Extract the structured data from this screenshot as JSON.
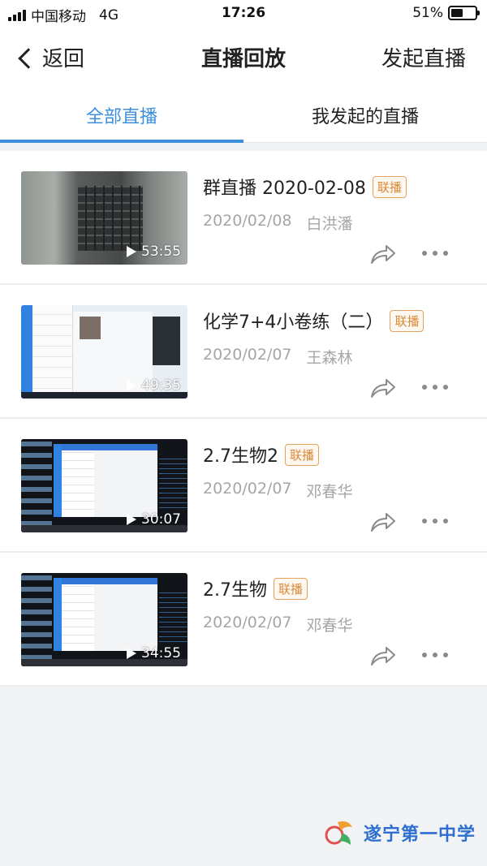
{
  "status_bar": {
    "carrier": "中国移动",
    "network": "4G",
    "time": "17:26",
    "battery": "51%",
    "battery_level": 0.51
  },
  "nav": {
    "back_label": "返回",
    "title": "直播回放",
    "action_label": "发起直播"
  },
  "tabs": [
    {
      "label": "全部直播",
      "active": true
    },
    {
      "label": "我发起的直播",
      "active": false
    }
  ],
  "items": [
    {
      "title": "群直播 2020-02-08",
      "badge": "联播",
      "date": "2020/02/08",
      "author": "白洪潘",
      "duration": "53:55",
      "thumbnail": "keyboard-photo"
    },
    {
      "title": "化学7+4小卷练（二）",
      "badge": "联播",
      "date": "2020/02/07",
      "author": "王森林",
      "duration": "49:35",
      "thumbnail": "chat-app-screen"
    },
    {
      "title": "2.7生物2",
      "badge": "联播",
      "date": "2020/02/07",
      "author": "邓春华",
      "duration": "30:07",
      "thumbnail": "desktop-screen"
    },
    {
      "title": "2.7生物",
      "badge": "联播",
      "date": "2020/02/07",
      "author": "邓春华",
      "duration": "34:55",
      "thumbnail": "desktop-screen"
    }
  ],
  "watermark": {
    "text": "遂宁第一中学"
  },
  "colors": {
    "accent": "#3d8fdc",
    "badge": "#d98a3c",
    "meta": "#a6a6a6"
  }
}
